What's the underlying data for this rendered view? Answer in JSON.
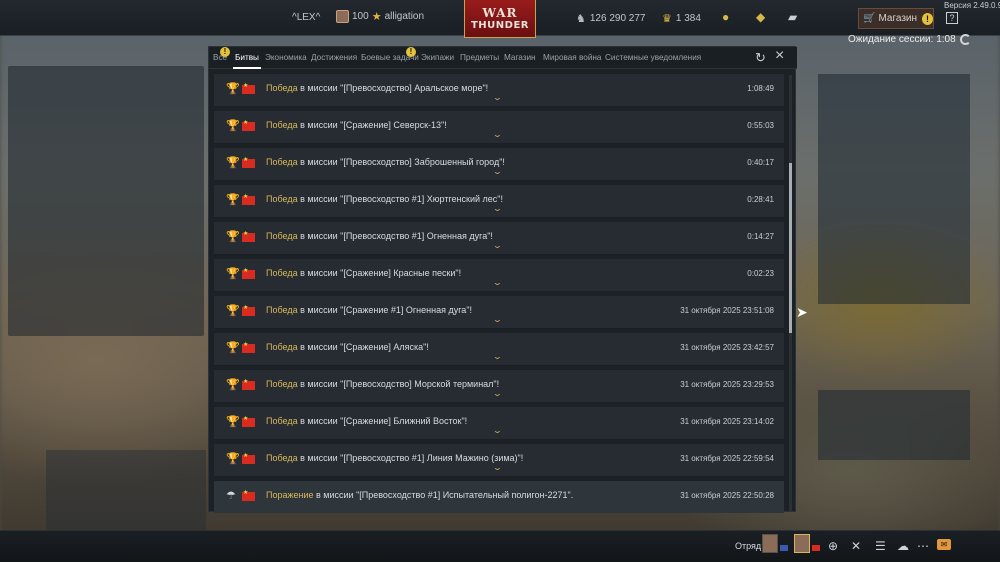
{
  "header": {
    "version": "Версия 2.49.0.98",
    "nickname": "^LEX^",
    "profile_count": "100",
    "profile_name": "alligation",
    "logo_line1": "WAR",
    "logo_line2": "THUNDER",
    "silver_lions": "126 290 277",
    "golden_eagles": "1 384",
    "shop_label": "Магазин",
    "shop_badge": "!",
    "help": "?",
    "session_wait": "Ожидание сессии: 1:08"
  },
  "modal": {
    "tabs": [
      {
        "label": "Все",
        "active": false,
        "badge": "!"
      },
      {
        "label": "Битвы",
        "active": true,
        "badge": ""
      },
      {
        "label": "Экономика",
        "active": false,
        "badge": ""
      },
      {
        "label": "Достижения",
        "active": false,
        "badge": ""
      },
      {
        "label": "Боевые задачи",
        "active": false,
        "badge": "!"
      },
      {
        "label": "Экипажи",
        "active": false,
        "badge": ""
      },
      {
        "label": "Предметы",
        "active": false,
        "badge": ""
      },
      {
        "label": "Магазин",
        "active": false,
        "badge": ""
      },
      {
        "label": "Мировая война",
        "active": false,
        "badge": ""
      },
      {
        "label": "Системные уведомления",
        "active": false,
        "badge": ""
      }
    ],
    "rows": [
      {
        "result": "Победа",
        "text": " в миссии \"[Превосходство] Аральское море\"!",
        "time": "1:08:49",
        "defeat": false
      },
      {
        "result": "Победа",
        "text": " в миссии \"[Сражение] Северск-13\"!",
        "time": "0:55:03",
        "defeat": false
      },
      {
        "result": "Победа",
        "text": " в миссии \"[Превосходство] Заброшенный город\"!",
        "time": "0:40:17",
        "defeat": false
      },
      {
        "result": "Победа",
        "text": " в миссии \"[Превосходство #1] Хюртгенский лес\"!",
        "time": "0:28:41",
        "defeat": false
      },
      {
        "result": "Победа",
        "text": " в миссии \"[Превосходство #1] Огненная дуга\"!",
        "time": "0:14:27",
        "defeat": false
      },
      {
        "result": "Победа",
        "text": " в миссии \"[Сражение] Красные пески\"!",
        "time": "0:02:23",
        "defeat": false
      },
      {
        "result": "Победа",
        "text": " в миссии \"[Сражение #1] Огненная дуга\"!",
        "time": "31 октября 2025 23:51:08",
        "defeat": false
      },
      {
        "result": "Победа",
        "text": " в миссии \"[Сражение] Аляска\"!",
        "time": "31 октября 2025 23:42:57",
        "defeat": false
      },
      {
        "result": "Победа",
        "text": " в миссии \"[Превосходство] Морской терминал\"!",
        "time": "31 октября 2025 23:29:53",
        "defeat": false
      },
      {
        "result": "Победа",
        "text": " в миссии \"[Сражение] Ближний Восток\"!",
        "time": "31 октября 2025 23:14:02",
        "defeat": false
      },
      {
        "result": "Победа",
        "text": " в миссии \"[Превосходство #1] Линия Мажино (зима)\"!",
        "time": "31 октября 2025 22:59:54",
        "defeat": false
      },
      {
        "result": "Поражение",
        "text": " в миссии \"[Превосходство #1] Испытательный полигон-2271\".",
        "time": "31 октября 2025 22:50:28",
        "defeat": true
      }
    ],
    "scroll_position": 0.33
  },
  "footer": {
    "squad_label": "Отряд:"
  },
  "colors": {
    "accent_gold": "#d8b85a",
    "badge_yellow": "#e4c23a",
    "brand_red": "#9a1c1c"
  },
  "icons": [
    "silver-lions-icon",
    "golden-eagles-icon",
    "lightbulb-icon",
    "premium-icon",
    "coupon-icon",
    "shopping-cart-icon",
    "refresh-icon",
    "close-icon",
    "trophy-icon",
    "parachute-icon",
    "china-flag-icon",
    "chevron-down-icon"
  ]
}
